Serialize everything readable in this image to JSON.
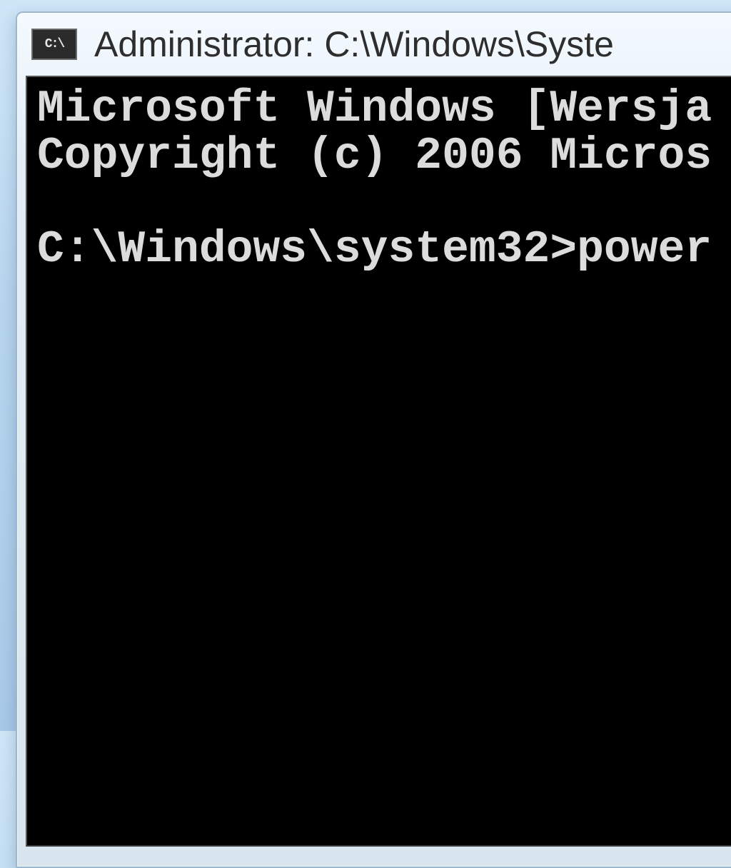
{
  "window": {
    "sysicon_label": "C:\\",
    "title": "Administrator: C:\\Windows\\Syste"
  },
  "terminal": {
    "line1": "Microsoft Windows [Wersja",
    "line2": "Copyright (c) 2006 Micros",
    "blank": "",
    "promptline": "C:\\Windows\\system32>power"
  }
}
